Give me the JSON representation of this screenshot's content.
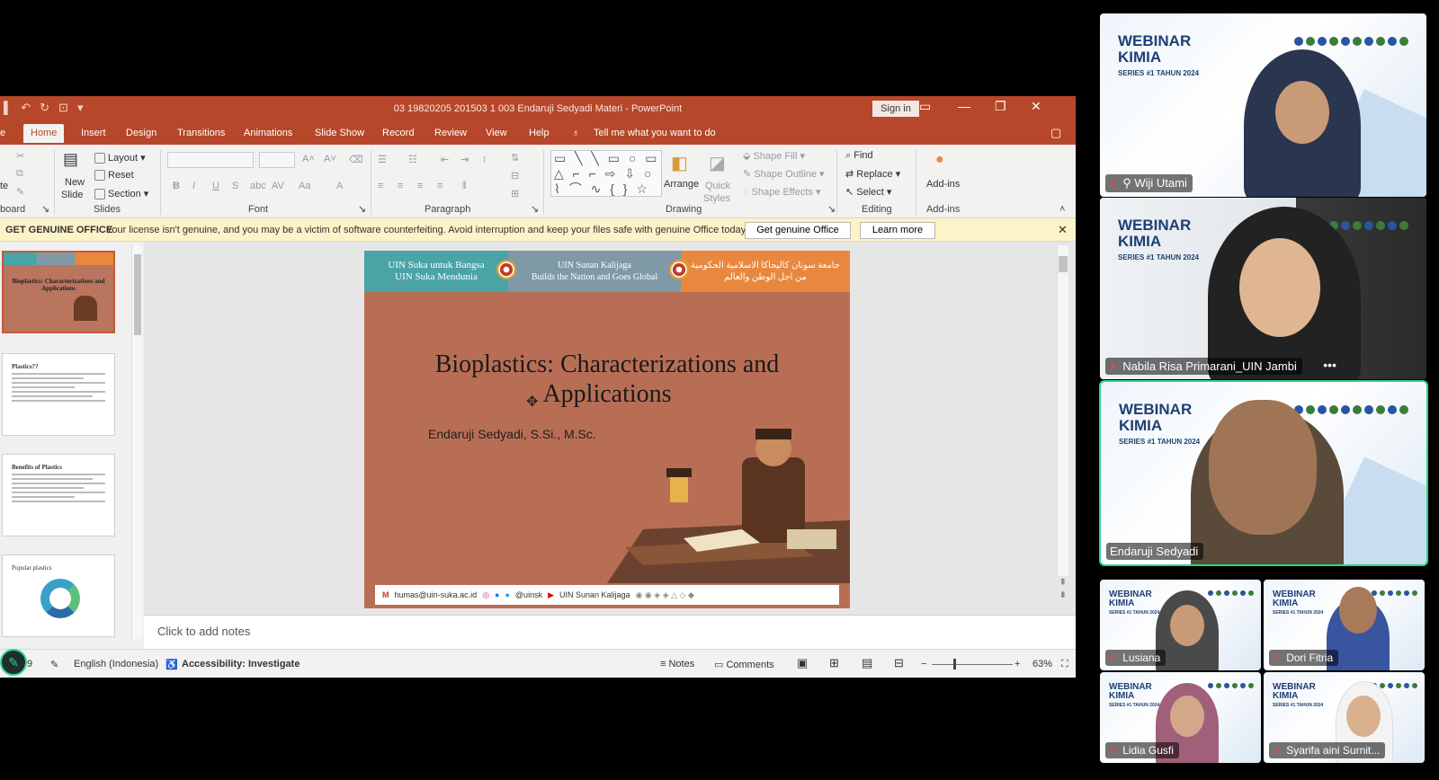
{
  "titlebar": {
    "doc_title": "03 19820205 201503 1 003 Endaruji Sedyadi Materi  -  PowerPoint",
    "sign_in": "Sign in"
  },
  "tabs": [
    {
      "label": "e"
    },
    {
      "label": "Home"
    },
    {
      "label": "Insert"
    },
    {
      "label": "Design"
    },
    {
      "label": "Transitions"
    },
    {
      "label": "Animations"
    },
    {
      "label": "Slide Show"
    },
    {
      "label": "Record"
    },
    {
      "label": "Review"
    },
    {
      "label": "View"
    },
    {
      "label": "Help"
    }
  ],
  "tell_me": "Tell me what you want to do",
  "ribbon": {
    "clipboard": {
      "paste": "te",
      "group": "board"
    },
    "slides": {
      "new_slide": "New",
      "new_slide2": "Slide",
      "layout": "Layout",
      "reset": "Reset",
      "section": "Section",
      "group": "Slides"
    },
    "font": {
      "group": "Font"
    },
    "paragraph": {
      "group": "Paragraph"
    },
    "drawing": {
      "arrange": "Arrange",
      "quick_styles": "Quick",
      "quick_styles2": "Styles",
      "shape_fill": "Shape Fill",
      "shape_outline": "Shape Outline",
      "shape_effects": "Shape Effects",
      "group": "Drawing"
    },
    "editing": {
      "find": "Find",
      "replace": "Replace",
      "select": "Select",
      "group": "Editing"
    },
    "addins": {
      "label": "Add-ins",
      "group": "Add-ins"
    }
  },
  "message_bar": {
    "title": "GET GENUINE OFFICE",
    "text": "Your license isn't genuine, and you may be a victim of software counterfeiting. Avoid interruption and keep your files safe with genuine Office today.",
    "btn_genuine": "Get genuine Office",
    "btn_learn": "Learn more"
  },
  "thumbnails": [
    {
      "title": "Bioplastics: Characterizations and Applications"
    },
    {
      "title": "Plastics??"
    },
    {
      "title": "Benefits of Plastics"
    },
    {
      "title": "Popular plastics"
    }
  ],
  "slide": {
    "banner_left_1": "UIN Suka untuk Bangsa",
    "banner_left_2": "UIN Suka Mendunia",
    "banner_mid_1": "UIN Sunan Kalijaga",
    "banner_mid_2": "Builds the Nation and Goes Global",
    "banner_right_1": "جامعة سونان كاليجاكا الاسلامية الحكومية",
    "banner_right_2": "من اجل الوطن والعالم",
    "title_line1": "Bioplastics: Characterizations and",
    "title_line2": "Applications",
    "author": "Endaruji Sedyadi, S.Si., M.Sc.",
    "footer_email": "humas@uin-suka.ac.id",
    "footer_social": "@uinsk",
    "footer_yt": "UIN Sunan Kalijaga"
  },
  "notes_placeholder": "Click to add notes",
  "status": {
    "slide_no": "9",
    "language": "English (Indonesia)",
    "accessibility": "Accessibility: Investigate",
    "notes": "Notes",
    "comments": "Comments",
    "zoom": "63%"
  },
  "participants": [
    {
      "name": "Wiji Utami"
    },
    {
      "name": "Nabila Risa Primarani_UIN Jambi"
    },
    {
      "name": "Endaruji Sedyadi"
    },
    {
      "name": "Lusiana"
    },
    {
      "name": "Dori Fitria"
    },
    {
      "name": "Lidia Gusfi"
    },
    {
      "name": "Syarifa aini Surnit..."
    }
  ],
  "tile_brand": {
    "line1": "WEBINAR",
    "line2": "KIMIA",
    "series": "SERIES #1 TAHUN 2024"
  },
  "colors": {
    "ppt_accent": "#b7472a",
    "active_speaker": "#2fd68a",
    "slide_bg": "#b86e55"
  }
}
